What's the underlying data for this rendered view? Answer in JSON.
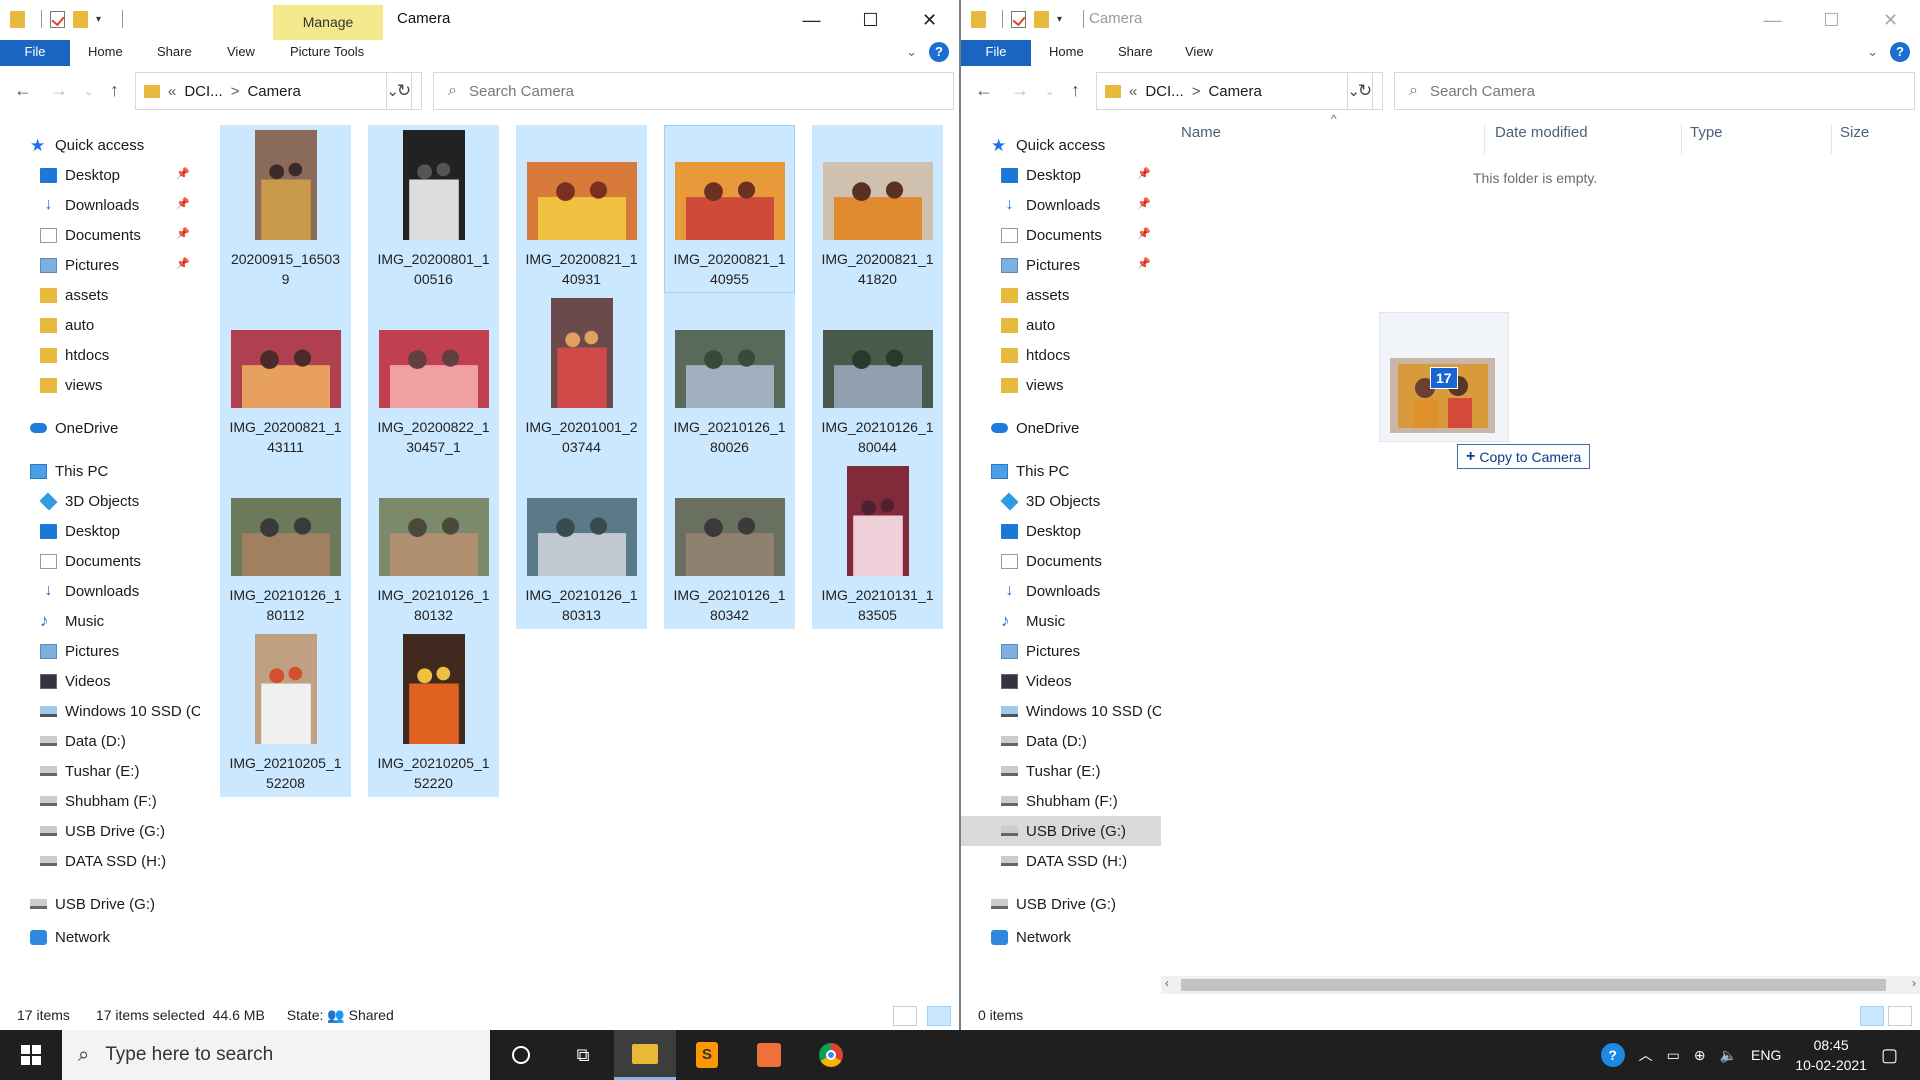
{
  "left": {
    "manage_label": "Manage",
    "title": "Camera",
    "tabs": [
      "File",
      "Home",
      "Share",
      "View",
      "Picture Tools"
    ],
    "breadcrumb": [
      "«",
      "DCI...",
      ">",
      "Camera"
    ],
    "search_placeholder": "Search Camera",
    "files": [
      {
        "name": "20200915_165039",
        "l1": "20200915_16503",
        "l2": "9",
        "thumb": "portrait"
      },
      {
        "name": "IMG_20200801_100516",
        "l1": "IMG_20200801_1",
        "l2": "00516",
        "thumb": "portrait"
      },
      {
        "name": "IMG_20200821_140931",
        "l1": "IMG_20200821_1",
        "l2": "40931",
        "thumb": "landscape"
      },
      {
        "name": "IMG_20200821_140955",
        "l1": "IMG_20200821_1",
        "l2": "40955",
        "thumb": "landscape"
      },
      {
        "name": "IMG_20200821_141820",
        "l1": "IMG_20200821_1",
        "l2": "41820",
        "thumb": "landscape"
      },
      {
        "name": "IMG_20200821_143111",
        "l1": "IMG_20200821_1",
        "l2": "43111",
        "thumb": "landscape"
      },
      {
        "name": "IMG_20200822_130457_1",
        "l1": "IMG_20200822_1",
        "l2": "30457_1",
        "thumb": "landscape"
      },
      {
        "name": "IMG_20201001_203744",
        "l1": "IMG_20201001_2",
        "l2": "03744",
        "thumb": "portrait"
      },
      {
        "name": "IMG_20210126_180026",
        "l1": "IMG_20210126_1",
        "l2": "80026",
        "thumb": "landscape"
      },
      {
        "name": "IMG_20210126_180044",
        "l1": "IMG_20210126_1",
        "l2": "80044",
        "thumb": "landscape"
      },
      {
        "name": "IMG_20210126_180112",
        "l1": "IMG_20210126_1",
        "l2": "80112",
        "thumb": "landscape"
      },
      {
        "name": "IMG_20210126_180132",
        "l1": "IMG_20210126_1",
        "l2": "80132",
        "thumb": "landscape"
      },
      {
        "name": "IMG_20210126_180313",
        "l1": "IMG_20210126_1",
        "l2": "80313",
        "thumb": "landscape"
      },
      {
        "name": "IMG_20210126_180342",
        "l1": "IMG_20210126_1",
        "l2": "80342",
        "thumb": "landscape"
      },
      {
        "name": "IMG_20210131_183505",
        "l1": "IMG_20210131_1",
        "l2": "83505",
        "thumb": "portrait"
      },
      {
        "name": "IMG_20210205_152208",
        "l1": "IMG_20210205_1",
        "l2": "52208",
        "thumb": "portrait"
      },
      {
        "name": "IMG_20210205_152220",
        "l1": "IMG_20210205_1",
        "l2": "52220",
        "thumb": "portrait"
      }
    ],
    "status": {
      "count": "17 items",
      "selected": "17 items selected",
      "size": "44.6 MB",
      "state": "State:",
      "shared": "Shared"
    }
  },
  "right": {
    "title": "Camera",
    "tabs": [
      "File",
      "Home",
      "Share",
      "View"
    ],
    "breadcrumb": [
      "«",
      "DCI...",
      ">",
      "Camera"
    ],
    "search_placeholder": "Search Camera",
    "columns": [
      "Name",
      "Date modified",
      "Type",
      "Size"
    ],
    "empty_text": "This folder is empty.",
    "drag_count": "17",
    "drop_tip": "Copy to Camera",
    "status": {
      "count": "0 items"
    }
  },
  "nav": [
    {
      "label": "Quick access",
      "icon": "star-icon",
      "indent": 1,
      "pin": false
    },
    {
      "label": "Desktop",
      "icon": "desktop-icon",
      "indent": 2,
      "pin": true
    },
    {
      "label": "Downloads",
      "icon": "download-icon",
      "indent": 2,
      "pin": true
    },
    {
      "label": "Documents",
      "icon": "documents-icon",
      "indent": 2,
      "pin": true
    },
    {
      "label": "Pictures",
      "icon": "pictures-icon",
      "indent": 2,
      "pin": true
    },
    {
      "label": "assets",
      "icon": "folder-icon",
      "indent": 2,
      "pin": false
    },
    {
      "label": "auto",
      "icon": "folder-icon",
      "indent": 2,
      "pin": false
    },
    {
      "label": "htdocs",
      "icon": "folder-icon",
      "indent": 2,
      "pin": false
    },
    {
      "label": "views",
      "icon": "folder-icon",
      "indent": 2,
      "pin": false
    },
    {
      "label": "OneDrive",
      "icon": "onedrive-icon",
      "indent": 1,
      "pin": false,
      "gap": true
    },
    {
      "label": "This PC",
      "icon": "this-pc-icon",
      "indent": 1,
      "pin": false,
      "gap": true
    },
    {
      "label": "3D Objects",
      "icon": "3d-objects-icon",
      "indent": 2,
      "pin": false
    },
    {
      "label": "Desktop",
      "icon": "desktop-icon",
      "indent": 2,
      "pin": false
    },
    {
      "label": "Documents",
      "icon": "documents-icon",
      "indent": 2,
      "pin": false
    },
    {
      "label": "Downloads",
      "icon": "download-icon",
      "indent": 2,
      "pin": false
    },
    {
      "label": "Music",
      "icon": "music-icon",
      "indent": 2,
      "pin": false
    },
    {
      "label": "Pictures",
      "icon": "pictures-icon",
      "indent": 2,
      "pin": false
    },
    {
      "label": "Videos",
      "icon": "videos-icon",
      "indent": 2,
      "pin": false
    },
    {
      "label": "Windows 10 SSD (C",
      "icon": "windows-drive-icon",
      "indent": 2,
      "pin": false
    },
    {
      "label": "Data (D:)",
      "icon": "drive-icon",
      "indent": 2,
      "pin": false
    },
    {
      "label": "Tushar (E:)",
      "icon": "drive-icon",
      "indent": 2,
      "pin": false
    },
    {
      "label": "Shubham (F:)",
      "icon": "drive-icon",
      "indent": 2,
      "pin": false
    },
    {
      "label": "USB Drive (G:)",
      "icon": "usb-drive-icon",
      "indent": 2,
      "pin": false
    },
    {
      "label": "DATA SSD (H:)",
      "icon": "drive-icon",
      "indent": 2,
      "pin": false
    },
    {
      "label": "USB Drive (G:)",
      "icon": "usb-drive-icon",
      "indent": 1,
      "pin": false,
      "gap": true
    },
    {
      "label": "Network",
      "icon": "network-icon",
      "indent": 1,
      "pin": false,
      "gap": true
    }
  ],
  "taskbar": {
    "search_placeholder": "Type here to search",
    "lang": "ENG",
    "time": "08:45",
    "date": "10-02-2021"
  },
  "colors": {
    "selection": "#cce8ff",
    "accent": "#1a65c0",
    "manage": "#f3e98c"
  }
}
